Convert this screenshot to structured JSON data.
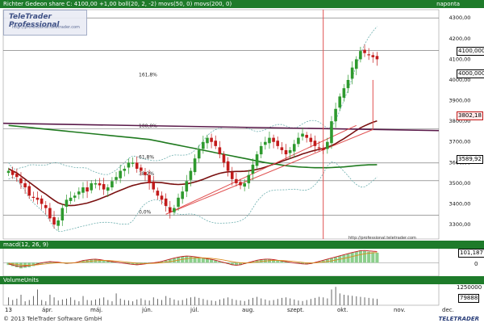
{
  "header": {
    "title": "Richter Gedeon share C: 4100,00 +1,00 boll(20, 2, -2) movs(50, 0) movs(200, 0)",
    "period": "naponta"
  },
  "watermark": {
    "brand": "TeleTrader Professional",
    "url": "http://professional.teletrader.com",
    "url_bottom": "http://professional.teletrader.com"
  },
  "macd_panel": {
    "title": "macd(12, 26, 9)",
    "value_tag": "101,1877",
    "zero_label": "0"
  },
  "volume_panel": {
    "title": "VolumeUnits",
    "scale_label": "1250000",
    "value_tag": "79888"
  },
  "footer": {
    "copyright": "© 2013 TeleTrader Software GmbH",
    "logo_text": "TELETRADER"
  },
  "price_tags": {
    "last": "4100,000",
    "near_last": "4000,000",
    "movs50": "3802,18",
    "movs200": "3589,92"
  },
  "colors": {
    "header_bg": "#1e7b2a",
    "up_candle": "#2e9a2e",
    "down_candle": "#c21b1b",
    "movs50": "#7a1010",
    "movs200": "#1f7a1f",
    "bollinger": "#6fb0b0",
    "trendline_red": "#e05050",
    "resistance_purple": "#5a1a4a",
    "vertical_marker": "#e05050"
  },
  "chart_data": {
    "type": "candlestick",
    "title": "Richter Gedeon share",
    "ylim": [
      3230,
      4340
    ],
    "y_ticks": [
      4300,
      4200,
      4100,
      4000,
      3900,
      3800,
      3700,
      3600,
      3500,
      3400,
      3300
    ],
    "y_tick_labels": [
      "4300,00",
      "4200,00",
      "4100,00",
      "4000,00",
      "3900,00",
      "3800,00",
      "3700,00",
      "3600,00",
      "3500,00",
      "3400,00",
      "3300,00"
    ],
    "x_tick_labels": [
      "13",
      "ápr.",
      "máj.",
      "jún.",
      "júl.",
      "aug.",
      "szept.",
      "okt.",
      "nov.",
      "dec."
    ],
    "fib_levels": [
      {
        "label": "161,8%",
        "value": 4010
      },
      {
        "label": "100,0%",
        "value": 3762
      },
      {
        "label": "61,8%",
        "value": 3612
      },
      {
        "label": "38,2%",
        "value": 3530
      },
      {
        "label": "0,0%",
        "value": 3345
      }
    ],
    "horizontal_lines": [
      4300,
      4142,
      3764,
      3598,
      3512,
      3345
    ],
    "series": [
      {
        "kind": "close",
        "values": [
          3560,
          3540,
          3530,
          3500,
          3480,
          3440,
          3430,
          3420,
          3400,
          3380,
          3330,
          3300,
          3320,
          3380,
          3420,
          3430,
          3440,
          3460,
          3480,
          3460,
          3500,
          3500,
          3490,
          3470,
          3480,
          3510,
          3530,
          3560,
          3570,
          3600,
          3600,
          3570,
          3560,
          3540,
          3500,
          3470,
          3440,
          3420,
          3390,
          3360,
          3380,
          3430,
          3460,
          3510,
          3560,
          3620,
          3660,
          3700,
          3720,
          3700,
          3680,
          3640,
          3600,
          3560,
          3520,
          3500,
          3490,
          3500,
          3540,
          3590,
          3640,
          3680,
          3700,
          3720,
          3700,
          3680,
          3660,
          3640,
          3660,
          3690,
          3720,
          3740,
          3720,
          3700,
          3680,
          3670,
          3660,
          3700,
          3800,
          3860,
          3920,
          3960,
          4000,
          4060,
          4100,
          4140,
          4130,
          4120,
          4110,
          4100
        ]
      },
      {
        "name": "movs(50, 0)",
        "kind": "ma50",
        "values": [
          3570,
          3560,
          3550,
          3535,
          3520,
          3505,
          3490,
          3475,
          3460,
          3447,
          3432,
          3418,
          3405,
          3398,
          3393,
          3392,
          3393,
          3396,
          3400,
          3404,
          3410,
          3417,
          3424,
          3432,
          3440,
          3449,
          3458,
          3466,
          3474,
          3482,
          3489,
          3494,
          3499,
          3502,
          3504,
          3505,
          3504,
          3503,
          3500,
          3497,
          3495,
          3494,
          3495,
          3497,
          3501,
          3506,
          3512,
          3519,
          3527,
          3535,
          3542,
          3548,
          3552,
          3555,
          3556,
          3557,
          3557,
          3558,
          3560,
          3563,
          3567,
          3572,
          3578,
          3585,
          3592,
          3599,
          3606,
          3613,
          3620,
          3627,
          3634,
          3642,
          3648,
          3654,
          3659,
          3664,
          3668,
          3674,
          3682,
          3692,
          3704,
          3716,
          3729,
          3742,
          3756,
          3768,
          3778,
          3787,
          3795,
          3802
        ]
      },
      {
        "name": "movs(200, 0)",
        "kind": "ma200",
        "values": [
          3780,
          3778,
          3776,
          3774,
          3772,
          3770,
          3768,
          3766,
          3764,
          3762,
          3760,
          3758,
          3756,
          3754,
          3752,
          3750,
          3748,
          3746,
          3744,
          3742,
          3740,
          3738,
          3736,
          3734,
          3732,
          3730,
          3728,
          3726,
          3724,
          3722,
          3720,
          3718,
          3716,
          3714,
          3712,
          3708,
          3704,
          3700,
          3696,
          3692,
          3688,
          3684,
          3680,
          3676,
          3672,
          3668,
          3664,
          3660,
          3656,
          3652,
          3648,
          3644,
          3640,
          3636,
          3632,
          3628,
          3624,
          3620,
          3616,
          3612,
          3608,
          3604,
          3600,
          3597,
          3594,
          3591,
          3588,
          3585,
          3583,
          3581,
          3579,
          3578,
          3577,
          3576,
          3575,
          3575,
          3575,
          3575,
          3576,
          3577,
          3578,
          3579,
          3581,
          3583,
          3585,
          3587,
          3588,
          3589,
          3589,
          3590
        ]
      }
    ],
    "macd": {
      "ylim": [
        -120,
        140
      ],
      "histogram": [
        -20,
        -30,
        -40,
        -50,
        -45,
        -40,
        -30,
        -20,
        -10,
        0,
        10,
        5,
        0,
        -5,
        -10,
        -5,
        0,
        10,
        20,
        25,
        30,
        30,
        25,
        20,
        15,
        10,
        5,
        0,
        -5,
        -10,
        -15,
        -20,
        -15,
        -10,
        -5,
        0,
        5,
        10,
        20,
        30,
        40,
        50,
        55,
        60,
        55,
        50,
        45,
        40,
        35,
        30,
        20,
        10,
        0,
        -10,
        -20,
        -25,
        -20,
        -10,
        0,
        10,
        20,
        25,
        30,
        30,
        25,
        20,
        15,
        10,
        5,
        0,
        -5,
        -10,
        -15,
        -10,
        0,
        10,
        20,
        30,
        40,
        50,
        60,
        70,
        80,
        90,
        100,
        110,
        105,
        100,
        95,
        90
      ],
      "macd_line": [
        -10,
        -20,
        -30,
        -35,
        -30,
        -25,
        -20,
        -10,
        0,
        5,
        10,
        8,
        5,
        0,
        -5,
        -3,
        0,
        10,
        20,
        25,
        30,
        32,
        28,
        22,
        15,
        10,
        5,
        0,
        -5,
        -10,
        -15,
        -18,
        -15,
        -10,
        -5,
        0,
        5,
        12,
        22,
        32,
        42,
        50,
        56,
        60,
        58,
        54,
        48,
        42,
        36,
        30,
        22,
        12,
        2,
        -8,
        -18,
        -22,
        -18,
        -8,
        2,
        12,
        22,
        28,
        32,
        32,
        28,
        22,
        16,
        10,
        4,
        -2,
        -6,
        -10,
        -12,
        -8,
        2,
        12,
        22,
        32,
        42,
        52,
        62,
        72,
        82,
        92,
        100,
        108,
        110,
        106,
        103,
        101
      ],
      "signal_line": [
        -5,
        -10,
        -15,
        -20,
        -22,
        -22,
        -21,
        -18,
        -14,
        -10,
        -6,
        -3,
        -1,
        -1,
        -2,
        -2,
        -1,
        2,
        6,
        10,
        14,
        18,
        20,
        21,
        20,
        18,
        15,
        12,
        8,
        4,
        0,
        -4,
        -6,
        -7,
        -7,
        -5,
        -3,
        0,
        5,
        10,
        16,
        23,
        30,
        36,
        41,
        44,
        45,
        44,
        42,
        39,
        35,
        30,
        24,
        17,
        10,
        4,
        0,
        -2,
        -1,
        2,
        6,
        11,
        15,
        19,
        21,
        21,
        20,
        18,
        15,
        11,
        7,
        3,
        -1,
        -2,
        -1,
        2,
        6,
        11,
        17,
        24,
        31,
        39,
        47,
        56,
        65,
        73,
        80,
        85,
        89,
        92
      ]
    },
    "volume": [
      30,
      20,
      25,
      40,
      15,
      20,
      35,
      60,
      20,
      15,
      40,
      30,
      18,
      22,
      25,
      30,
      20,
      15,
      35,
      20,
      18,
      22,
      26,
      30,
      20,
      15,
      45,
      25,
      20,
      18,
      15,
      22,
      26,
      20,
      18,
      30,
      24,
      20,
      35,
      28,
      22,
      18,
      20,
      26,
      30,
      32,
      28,
      24,
      20,
      18,
      16,
      22,
      26,
      30,
      24,
      20,
      18,
      16,
      22,
      28,
      32,
      26,
      22,
      18,
      20,
      24,
      28,
      30,
      26,
      22,
      18,
      16,
      20,
      24,
      28,
      32,
      30,
      26,
      60,
      70,
      45,
      40,
      38,
      36,
      34,
      32,
      30,
      28,
      26,
      24
    ]
  }
}
